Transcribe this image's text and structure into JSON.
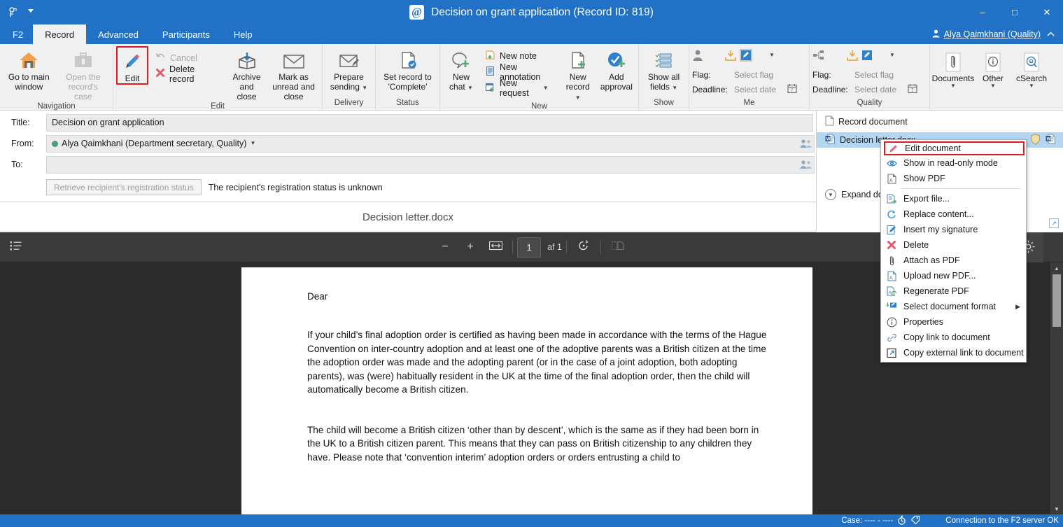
{
  "window": {
    "title": "Decision on grant application (Record ID: 819)",
    "app_icon": "at-sign-icon",
    "minimize": "–",
    "maximize": "□",
    "close": "✕"
  },
  "tabs": [
    {
      "label": "F2",
      "active": false
    },
    {
      "label": "Record",
      "active": true
    },
    {
      "label": "Advanced",
      "active": false
    },
    {
      "label": "Participants",
      "active": false
    },
    {
      "label": "Help",
      "active": false
    }
  ],
  "user": {
    "name": "Alya Qaimkhani (Quality)",
    "icon": "user-icon"
  },
  "ribbon": {
    "groups": [
      {
        "title": "Navigation",
        "buttons": [
          {
            "label": "Go to main window",
            "icon": "home-icon",
            "disabled": false,
            "dropdown": false
          },
          {
            "label": "Open the record's case",
            "icon": "briefcase-icon",
            "disabled": true,
            "dropdown": true
          }
        ]
      },
      {
        "title": "Edit",
        "big": [
          {
            "label": "Edit",
            "icon": "pencil-icon",
            "highlighted": true
          }
        ],
        "small": [
          {
            "label": "Cancel",
            "icon": "undo-icon",
            "disabled": true
          },
          {
            "label": "Delete record",
            "icon": "red-x-icon",
            "disabled": false
          }
        ],
        "buttons": [
          {
            "label": "Archive and close",
            "icon": "archive-box-icon",
            "disabled": false
          },
          {
            "label": "Mark as unread and close",
            "icon": "envelope-icon",
            "disabled": false
          }
        ]
      },
      {
        "title": "Delivery",
        "buttons": [
          {
            "label": "Prepare sending",
            "icon": "envelope-pencil-icon",
            "disabled": false,
            "dropdown": true
          }
        ]
      },
      {
        "title": "Status",
        "buttons": [
          {
            "label": "Set record to 'Complete'",
            "icon": "document-check-icon",
            "disabled": false
          }
        ]
      },
      {
        "title": "New",
        "buttons": [
          {
            "label": "New chat",
            "icon": "chat-plus-icon",
            "disabled": false,
            "dropdown": true
          }
        ],
        "small": [
          {
            "label": "New note",
            "icon": "note-plus-icon",
            "disabled": false
          },
          {
            "label": "New annotation",
            "icon": "annotation-icon",
            "disabled": false
          },
          {
            "label": "New request",
            "icon": "request-plus-icon",
            "disabled": false,
            "dropdown": true
          }
        ],
        "buttons2": [
          {
            "label": "New record",
            "icon": "document-plus-icon",
            "disabled": false,
            "dropdown": true
          },
          {
            "label": "Add approval",
            "icon": "check-circle-plus-icon",
            "disabled": false
          }
        ]
      },
      {
        "title": "Show",
        "buttons": [
          {
            "label": "Show all fields",
            "icon": "list-check-icon",
            "disabled": false,
            "dropdown": true
          }
        ]
      },
      {
        "title": "Me",
        "flag": {
          "label": "Flag:",
          "value": "Select flag"
        },
        "deadline": {
          "label": "Deadline:",
          "value": "Select date"
        },
        "icons": [
          "person-icon",
          "flag-download-icon",
          "flag-edit-icon",
          "calendar-icon",
          "chevron-down-icon"
        ]
      },
      {
        "title": "Quality",
        "flag": {
          "label": "Flag:",
          "value": "Select flag"
        },
        "deadline": {
          "label": "Deadline:",
          "value": "Select date"
        },
        "icons": [
          "org-icon",
          "flag-download-icon",
          "flag-edit-icon",
          "calendar-icon",
          "chevron-down-icon"
        ]
      },
      {
        "title": "",
        "buttons": [
          {
            "label": "Documents",
            "icon": "paperclip-icon",
            "disabled": false,
            "dropdown": true
          },
          {
            "label": "Other",
            "icon": "info-icon",
            "disabled": false,
            "dropdown": true
          },
          {
            "label": "cSearch",
            "icon": "search-at-icon",
            "disabled": false,
            "dropdown": true
          }
        ]
      }
    ]
  },
  "form": {
    "title_label": "Title:",
    "title_value": "Decision on grant application",
    "from_label": "From:",
    "from_value": "Alya Qaimkhani (Department secretary, Quality)",
    "to_label": "To:",
    "to_value": "",
    "retrieve_button": "Retrieve recipient's registration status",
    "retrieve_note": "The recipient's registration status is unknown"
  },
  "documents_panel": {
    "items": [
      {
        "label": "Record document",
        "icon": "blank-document-icon",
        "selected": false
      },
      {
        "label": "Decision letter.docx",
        "icon": "word-document-icon",
        "selected": true
      }
    ],
    "expand_label": "Expand document area"
  },
  "preview": {
    "filename": "Decision letter.docx",
    "toolbar": {
      "sidebar_icon": "outline-list-icon",
      "zoom_out": "−",
      "zoom_in": "+",
      "fit_width_icon": "fit-width-icon",
      "page_current": "1",
      "page_total": "af 1",
      "rotate_icon": "rotate-icon",
      "layout_icon": "page-layout-icon",
      "settings_icon": "gear-icon"
    }
  },
  "document": {
    "salutation": "Dear",
    "paragraphs": [
      "If your child’s final adoption order is certified as having been made in accordance with the terms of the Hague Convention on inter-country adoption and at least one of the adoptive parents was a British citizen at the time the adoption order was made and the adopting parent (or in the case of a joint adoption, both adopting parents), was (were) habitually resident in the UK at the time of the final adoption order, then the child will automatically become a British citizen.",
      "The child will become a British citizen ‘other than by descent’, which is the same as if they had been born in the UK to a British citizen parent. This means that they can pass on British citizenship to any children they have. Please note that ‘convention interim’ adoption orders or orders entrusting a child to"
    ]
  },
  "context_menu": {
    "items": [
      {
        "label": "Edit document",
        "icon": "pencil-icon",
        "highlighted": true,
        "separator_after": false
      },
      {
        "label": "Show in read-only mode",
        "icon": "eye-icon",
        "highlighted": false,
        "separator_after": false
      },
      {
        "label": "Show PDF",
        "icon": "pdf-icon",
        "highlighted": false,
        "separator_after": true
      },
      {
        "label": "Export file...",
        "icon": "export-icon",
        "highlighted": false,
        "separator_after": false
      },
      {
        "label": "Replace content...",
        "icon": "refresh-icon",
        "highlighted": false,
        "separator_after": false
      },
      {
        "label": "Insert my signature",
        "icon": "signature-icon",
        "highlighted": false,
        "separator_after": false
      },
      {
        "label": "Delete",
        "icon": "red-x-icon",
        "highlighted": false,
        "separator_after": false
      },
      {
        "label": "Attach as PDF",
        "icon": "paperclip-icon",
        "highlighted": false,
        "separator_after": false
      },
      {
        "label": "Upload new PDF...",
        "icon": "pdf-upload-icon",
        "highlighted": false,
        "separator_after": false
      },
      {
        "label": "Regenerate PDF",
        "icon": "pdf-regen-icon",
        "highlighted": false,
        "separator_after": false
      },
      {
        "label": "Select document format",
        "icon": "format-icon",
        "highlighted": false,
        "submenu": "▶",
        "separator_after": false
      },
      {
        "label": "Properties",
        "icon": "info-icon",
        "highlighted": false,
        "separator_after": false
      },
      {
        "label": "Copy link to document",
        "icon": "link-icon",
        "highlighted": false,
        "separator_after": false
      },
      {
        "label": "Copy external link to document",
        "icon": "external-link-icon",
        "highlighted": false,
        "separator_after": false
      }
    ]
  },
  "statusbar": {
    "case_label": "Case: ---- - ----",
    "connection": "Connection to the F2 server OK",
    "icons": [
      "stopwatch-icon",
      "tag-icon"
    ]
  },
  "colors": {
    "brand_blue": "#2171c7",
    "ribbon_bg": "#f0f0f0",
    "highlight_red": "#e01b1b",
    "selection_blue": "#b5d6f0",
    "viewer_bg": "#2b2b2b",
    "toolbar_dark": "#3a3a3a"
  }
}
